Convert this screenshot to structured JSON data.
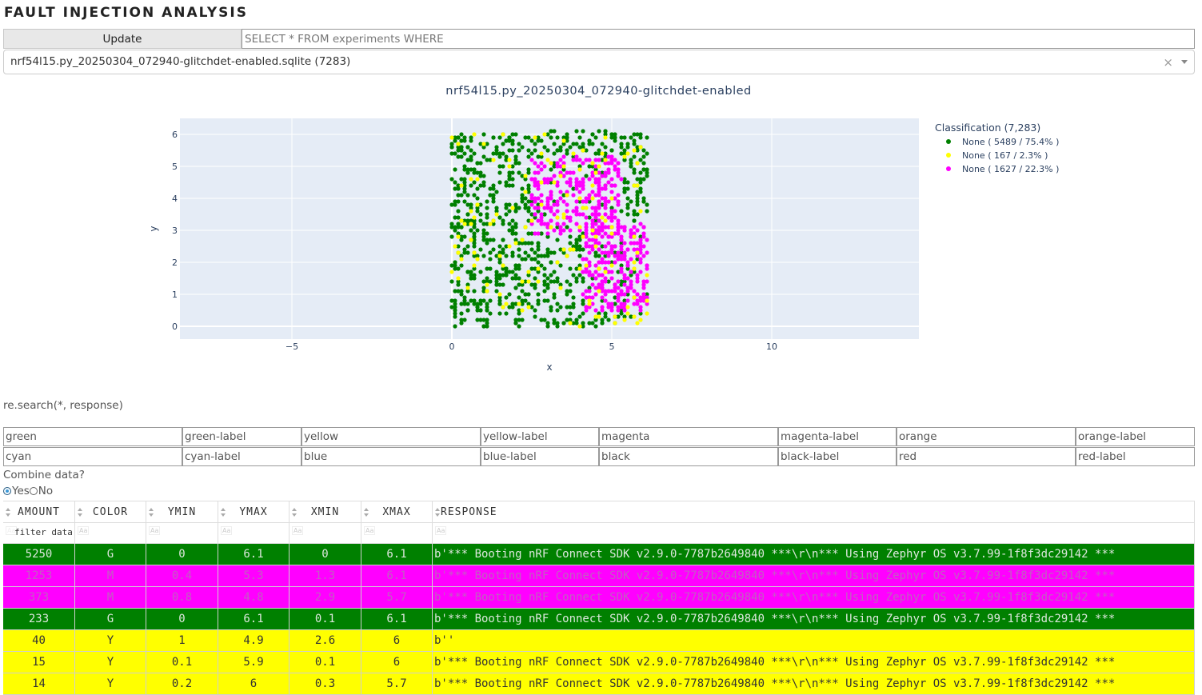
{
  "app": {
    "title": "FAULT INJECTION ANALYSIS",
    "update_label": "Update",
    "query_placeholder": "SELECT * FROM experiments WHERE",
    "dropdown_value": "nrf54l15.py_20250304_072940-glitchdet-enabled.sqlite (7283)",
    "dropdown_clear": "×"
  },
  "chart_data": {
    "type": "scatter",
    "title": "nrf54l15.py_20250304_072940-glitchdet-enabled",
    "xlabel": "x",
    "ylabel": "y",
    "xlim": [
      -8.5,
      14.6
    ],
    "ylim": [
      -0.4,
      6.5
    ],
    "xticks": [
      -5,
      0,
      5,
      10
    ],
    "xtick_labels": [
      "−5",
      "0",
      "5",
      "10"
    ],
    "yticks": [
      0,
      1,
      2,
      3,
      4,
      5,
      6
    ],
    "ytick_labels": [
      "0",
      "1",
      "2",
      "3",
      "4",
      "5",
      "6"
    ],
    "grid": true,
    "legend_position": "right",
    "legend_title": "Classification (7,283)",
    "series": [
      {
        "name": "None ( 5489 / 75.4% )",
        "color": "#008000",
        "count": 5489,
        "region": {
          "xmin": 0,
          "xmax": 6.1,
          "ymin": 0,
          "ymax": 6.1
        }
      },
      {
        "name": "None ( 167 / 2.3% )",
        "color": "#ffff00",
        "count": 167,
        "region": {
          "xmin": 0,
          "xmax": 6.1,
          "ymin": 0,
          "ymax": 6.1
        }
      },
      {
        "name": "None ( 1627 / 22.3% )",
        "color": "#ff00ff",
        "count": 1627,
        "regions": [
          {
            "xmin": 2.5,
            "xmax": 5.3,
            "ymin": 2.9,
            "ymax": 5.3
          },
          {
            "xmin": 4.1,
            "xmax": 6.1,
            "ymin": 0.5,
            "ymax": 3.2
          }
        ]
      }
    ]
  },
  "filters": {
    "regex_label": "re.search(*, response)",
    "row1": [
      "green",
      "green-label",
      "yellow",
      "yellow-label",
      "magenta",
      "magenta-label",
      "orange",
      "orange-label"
    ],
    "row2": [
      "cyan",
      "cyan-label",
      "blue",
      "blue-label",
      "black",
      "black-label",
      "red",
      "red-label"
    ]
  },
  "combine": {
    "label": "Combine data?",
    "options": [
      "Yes",
      "No"
    ],
    "selected": "Yes"
  },
  "table": {
    "columns": [
      "AMOUNT",
      "COLOR",
      "YMIN",
      "YMAX",
      "XMIN",
      "XMAX",
      "RESPONSE"
    ],
    "filter_placeholder": "filter data...",
    "aa": "Aa",
    "rows": [
      {
        "amount": "5250",
        "color": "G",
        "ymin": "0",
        "ymax": "6.1",
        "xmin": "0",
        "xmax": "6.1",
        "response": "b'*** Booting nRF Connect SDK v2.9.0-7787b2649840 ***\\r\\n*** Using Zephyr OS v3.7.99-1f8f3dc29142 ***",
        "bg": "#008000"
      },
      {
        "amount": "1253",
        "color": "M",
        "ymin": "0.4",
        "ymax": "5.3",
        "xmin": "1.3",
        "xmax": "6.1",
        "response": "b'*** Booting nRF Connect SDK v2.9.0-7787b2649840 ***\\r\\n*** Using Zephyr OS v3.7.99-1f8f3dc29142 ***",
        "bg": "#ff00ff"
      },
      {
        "amount": "373",
        "color": "M",
        "ymin": "0.8",
        "ymax": "4.8",
        "xmin": "2.9",
        "xmax": "5.7",
        "response": "b'*** Booting nRF Connect SDK v2.9.0-7787b2649840 ***\\r\\n*** Using Zephyr OS v3.7.99-1f8f3dc29142 ***",
        "bg": "#ff00ff"
      },
      {
        "amount": "233",
        "color": "G",
        "ymin": "0",
        "ymax": "6.1",
        "xmin": "0.1",
        "xmax": "6.1",
        "response": "b'*** Booting nRF Connect SDK v2.9.0-7787b2649840 ***\\r\\n*** Using Zephyr OS v3.7.99-1f8f3dc29142 ***",
        "bg": "#008000"
      },
      {
        "amount": "40",
        "color": "Y",
        "ymin": "1",
        "ymax": "4.9",
        "xmin": "2.6",
        "xmax": "6",
        "response": "b''",
        "bg": "#ffff00"
      },
      {
        "amount": "15",
        "color": "Y",
        "ymin": "0.1",
        "ymax": "5.9",
        "xmin": "0.1",
        "xmax": "6",
        "response": "b'*** Booting nRF Connect SDK v2.9.0-7787b2649840 ***\\r\\n*** Using Zephyr OS v3.7.99-1f8f3dc29142 ***",
        "bg": "#ffff00"
      },
      {
        "amount": "14",
        "color": "Y",
        "ymin": "0.2",
        "ymax": "6",
        "xmin": "0.3",
        "xmax": "5.7",
        "response": "b'*** Booting nRF Connect SDK v2.9.0-7787b2649840 ***\\r\\n*** Using Zephyr OS v3.7.99-1f8f3dc29142 ***",
        "bg": "#ffff00"
      }
    ]
  }
}
